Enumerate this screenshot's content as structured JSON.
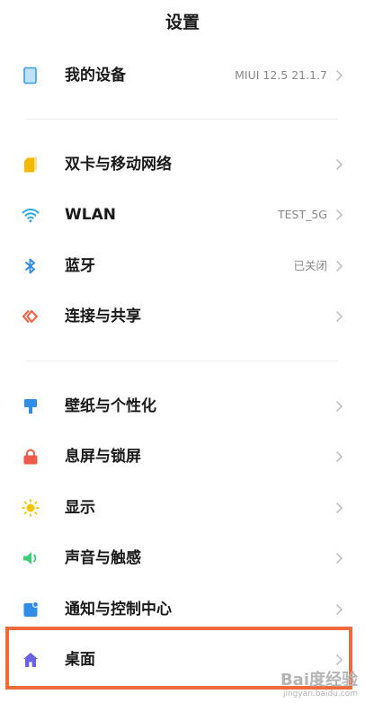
{
  "header": {
    "title": "设置"
  },
  "rows": [
    {
      "label": "我的设备",
      "value": "MIUI 12.5 21.1.7",
      "icon": "phone-device-icon"
    },
    {
      "label": "双卡与移动网络",
      "value": "",
      "icon": "sim-card-icon"
    },
    {
      "label": "WLAN",
      "value": "TEST_5G",
      "icon": "wifi-icon"
    },
    {
      "label": "蓝牙",
      "value": "已关闭",
      "icon": "bluetooth-icon"
    },
    {
      "label": "连接与共享",
      "value": "",
      "icon": "connection-share-icon"
    },
    {
      "label": "壁纸与个性化",
      "value": "",
      "icon": "wallpaper-brush-icon"
    },
    {
      "label": "息屏与锁屏",
      "value": "",
      "icon": "lock-icon"
    },
    {
      "label": "显示",
      "value": "",
      "icon": "brightness-sun-icon"
    },
    {
      "label": "声音与触感",
      "value": "",
      "icon": "speaker-icon"
    },
    {
      "label": "通知与控制中心",
      "value": "",
      "icon": "notification-icon"
    },
    {
      "label": "桌面",
      "value": "",
      "icon": "home-icon"
    }
  ],
  "colors": {
    "highlight": "#ef6b3b",
    "device": "#3a9ee8",
    "sim": "#f5b800",
    "wifi": "#2fa8e6",
    "bluetooth": "#2f8de8",
    "share": "#f0654a",
    "wallpaper": "#2f8de8",
    "lock": "#ef5a4a",
    "display": "#f5c400",
    "sound": "#3ccf7a",
    "notification": "#2f8de8",
    "home": "#6a62e8"
  },
  "watermark": {
    "main": "Bai度经验",
    "sub": "jingyan.baidu.com"
  }
}
